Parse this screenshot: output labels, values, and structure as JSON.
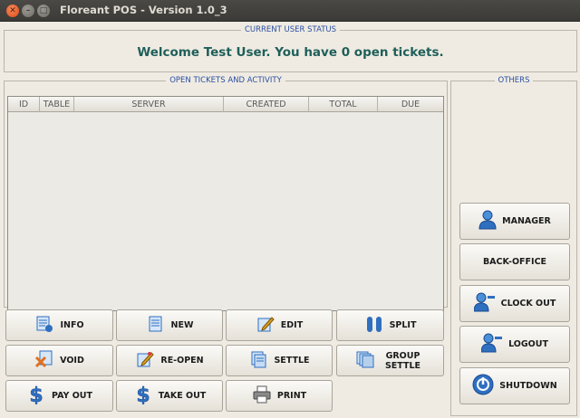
{
  "window": {
    "title": "Floreant POS - Version 1.0_3"
  },
  "status_panel": {
    "legend": "CURRENT USER STATUS",
    "welcome": "Welcome Test User. You have 0 open tickets."
  },
  "tickets_panel": {
    "legend": "OPEN TICKETS AND ACTIVITY",
    "columns": [
      "ID",
      "TABLE",
      "SERVER",
      "CREATED",
      "TOTAL",
      "DUE"
    ],
    "rows": []
  },
  "others_panel": {
    "legend": "OTHERS"
  },
  "actions": {
    "info": "INFO",
    "new": "NEW",
    "edit": "EDIT",
    "split": "SPLIT",
    "void": "VOID",
    "reopen": "RE-OPEN",
    "settle": "SETTLE",
    "group_settle": "GROUP SETTLE",
    "payout": "PAY OUT",
    "takeout": "TAKE OUT",
    "print": "PRINT"
  },
  "side_actions": {
    "manager": "MANAGER",
    "backoffice": "BACK-OFFICE",
    "clockout": "CLOCK OUT",
    "logout": "LOGOUT",
    "shutdown": "SHUTDOWN"
  },
  "icons": {
    "info": "info-doc-icon",
    "new": "new-doc-icon",
    "edit": "edit-pencil-icon",
    "split": "split-bars-icon",
    "void": "void-doc-icon",
    "reopen": "reopen-pencil-icon",
    "settle": "settle-doc-icon",
    "group_settle": "group-settle-doc-icon",
    "payout": "dollar-icon",
    "takeout": "dollar-icon",
    "print": "printer-icon",
    "manager": "user-icon",
    "clockout": "user-minus-icon",
    "logout": "user-minus-icon",
    "shutdown": "power-icon"
  },
  "colors": {
    "accent_blue": "#2a4fa3",
    "welcome_text": "#1f5f5a",
    "icon_blue": "#2f6fc0"
  }
}
